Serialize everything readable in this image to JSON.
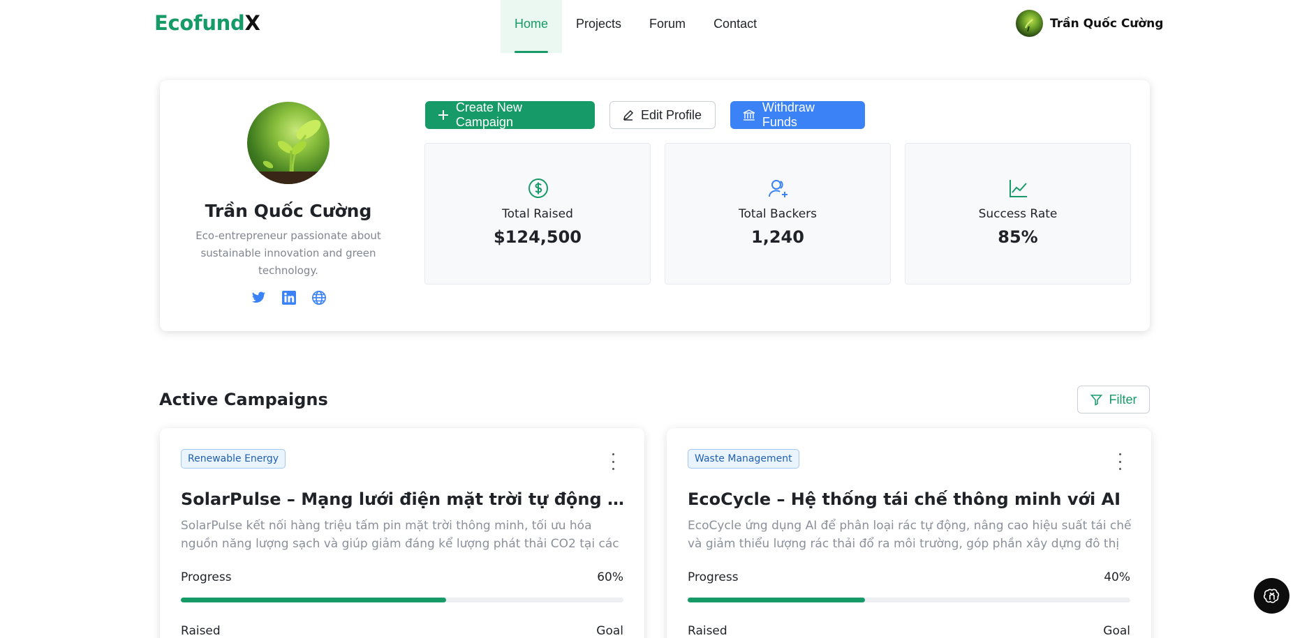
{
  "header": {
    "logo_primary": "Ecofund",
    "logo_accent": "X",
    "nav": [
      "Home",
      "Projects",
      "Forum",
      "Contact"
    ],
    "active_nav": "Home",
    "user_name": "Trần Quốc Cường"
  },
  "profile": {
    "name": "Trần Quốc Cường",
    "bio": "Eco-entrepreneur passionate about sustainable innovation and green technology.",
    "socials": [
      "twitter-icon",
      "linkedin-icon",
      "globe-icon"
    ],
    "actions": {
      "create": "Create New Campaign",
      "edit": "Edit Profile",
      "withdraw": "Withdraw Funds"
    },
    "stats": [
      {
        "label": "Total Raised",
        "value": "$124,500",
        "icon": "dollar-icon"
      },
      {
        "label": "Total Backers",
        "value": "1,240",
        "icon": "users-icon"
      },
      {
        "label": "Success Rate",
        "value": "85%",
        "icon": "chart-line-icon"
      }
    ]
  },
  "campaigns_section": {
    "title": "Active Campaigns",
    "filter_label": "Filter"
  },
  "campaigns": [
    {
      "category": "Renewable Energy",
      "title": "SolarPulse – Mạng lưới điện mặt trời tự động cho thành phố thông minh",
      "description": "SolarPulse kết nối hàng triệu tấm pin mặt trời thông minh, tối ưu hóa nguồn năng lượng sạch và giúp giảm đáng kể lượng phát thải CO2 tại các khu đô th...",
      "progress_label": "Progress",
      "progress_pct": "60%",
      "progress": 0.6,
      "raised_label": "Raised",
      "goal_label": "Goal"
    },
    {
      "category": "Waste Management",
      "title": "EcoCycle – Hệ thống tái chế thông minh với AI",
      "description": "EcoCycle ứng dụng AI để phân loại rác tự động, nâng cao hiệu suất tái chế và giảm thiểu lượng rác thải đổ ra môi trường, góp phần xây dựng đô thị xanh...",
      "progress_label": "Progress",
      "progress_pct": "40%",
      "progress": 0.4,
      "raised_label": "Raised",
      "goal_label": "Goal"
    }
  ],
  "colors": {
    "brand_green": "#169a67",
    "accent_blue": "#3b82f6",
    "badge_blue": "#1f5fae"
  }
}
